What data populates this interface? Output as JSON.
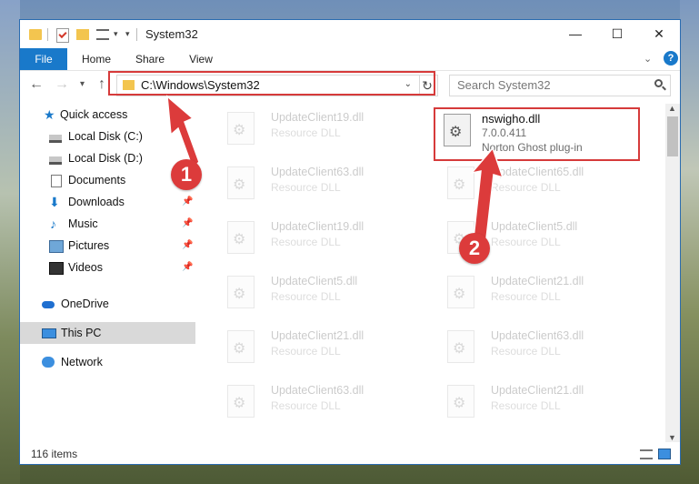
{
  "window": {
    "title": "System32",
    "minimize_glyph": "—",
    "maximize_glyph": "☐",
    "close_glyph": "✕"
  },
  "ribbon": {
    "tabs": [
      "File",
      "Home",
      "Share",
      "View"
    ],
    "help": "?"
  },
  "address_bar": {
    "path": "C:\\Windows\\System32",
    "refresh_glyph": "↻"
  },
  "search": {
    "placeholder": "Search System32"
  },
  "navigation": [
    {
      "label": "Quick access",
      "icon": "star-icon",
      "pinned": false
    },
    {
      "label": "Local Disk (C:)",
      "icon": "drive-icon",
      "pinned": true
    },
    {
      "label": "Local Disk (D:)",
      "icon": "drive-icon",
      "pinned": true
    },
    {
      "label": "Documents",
      "icon": "documents-icon",
      "pinned": true
    },
    {
      "label": "Downloads",
      "icon": "downloads-icon",
      "pinned": true
    },
    {
      "label": "Music",
      "icon": "music-icon",
      "pinned": true
    },
    {
      "label": "Pictures",
      "icon": "pictures-icon",
      "pinned": true
    },
    {
      "label": "Videos",
      "icon": "videos-icon",
      "pinned": true
    },
    {
      "label": "OneDrive",
      "icon": "onedrive-icon",
      "pinned": false
    },
    {
      "label": "This PC",
      "icon": "this-pc-icon",
      "pinned": false,
      "selected": true
    },
    {
      "label": "Network",
      "icon": "network-icon",
      "pinned": false
    }
  ],
  "files": {
    "highlighted": {
      "name": "nswigho.dll",
      "version": "7.0.0.411",
      "description": "Norton Ghost plug-in"
    },
    "left_column": [
      {
        "name": "UpdateClient19.dll",
        "type": "Resource DLL"
      },
      {
        "name": "UpdateClient63.dll",
        "type": "Resource DLL"
      },
      {
        "name": "UpdateClient19.dll",
        "type": "Resource DLL"
      },
      {
        "name": "UpdateClient5.dll",
        "type": "Resource DLL"
      },
      {
        "name": "UpdateClient21.dll",
        "type": "Resource DLL"
      },
      {
        "name": "UpdateClient63.dll",
        "type": "Resource DLL"
      }
    ],
    "right_column": [
      {
        "name": "UpdateClient65.dll",
        "type": "Resource DLL"
      },
      {
        "name": "UpdateClient5.dll",
        "type": "Resource DLL"
      },
      {
        "name": "UpdateClient21.dll",
        "type": "Resource DLL"
      },
      {
        "name": "UpdateClient63.dll",
        "type": "Resource DLL"
      },
      {
        "name": "UpdateClient21.dll",
        "type": "Resource DLL"
      }
    ]
  },
  "status": {
    "item_count": "116 items"
  },
  "callouts": [
    "1",
    "2"
  ],
  "colors": {
    "accent": "#1979ca",
    "highlight_red": "#d63a3a",
    "callout_red": "#dc3b3b"
  }
}
